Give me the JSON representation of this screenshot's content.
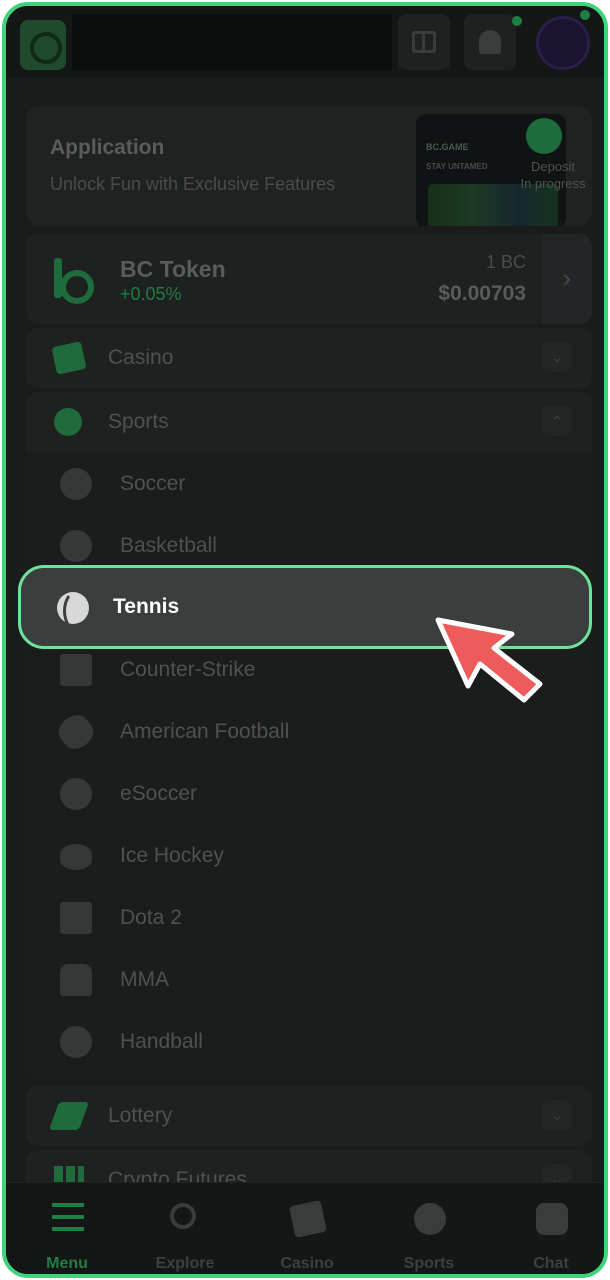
{
  "app_banner": {
    "title": "Application",
    "subtitle": "Unlock Fun with Exclusive Features",
    "image_brand": "BC.GAME",
    "image_tagline": "STAY UNTAMED",
    "deposit_text": "Deposit\nIn progress"
  },
  "token": {
    "name": "BC Token",
    "change": "+0.05%",
    "unit": "1 BC",
    "price": "$0.00703",
    "change_color": "#1f7d45"
  },
  "sections": {
    "casino": "Casino",
    "sports": "Sports",
    "lottery": "Lottery",
    "futures": "Crypto Futures"
  },
  "sports_items": [
    "Soccer",
    "Basketball",
    "Tennis",
    "Counter-Strike",
    "American Football",
    "eSoccer",
    "Ice Hockey",
    "Dota 2",
    "MMA",
    "Handball"
  ],
  "bottom_nav": {
    "menu": "Menu",
    "explore": "Explore",
    "casino": "Casino",
    "sports": "Sports",
    "chat": "Chat"
  },
  "colors": {
    "accent": "#3fd47a",
    "highlight_border": "#6fe39a",
    "pointer": "#ef5b5b",
    "background": "#1a1b1b"
  },
  "icons": {
    "gift": "gift-icon",
    "bell": "bell-icon",
    "pointer": "cursor-arrow-icon"
  }
}
